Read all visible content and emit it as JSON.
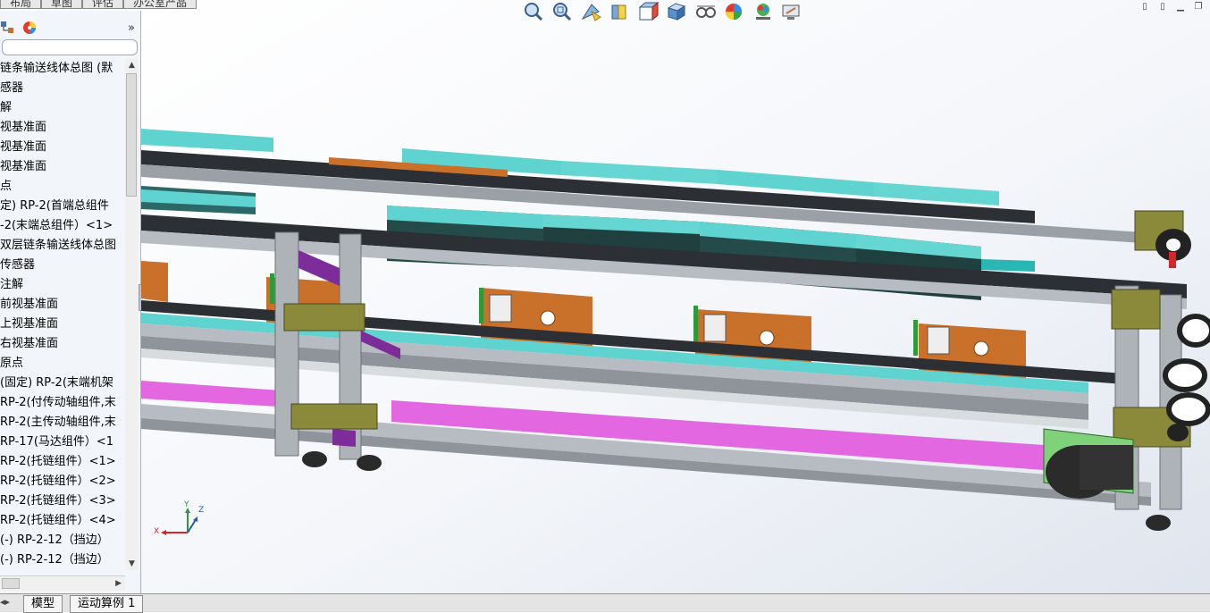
{
  "top_tabs": [
    "布局",
    "草图",
    "评估",
    "办公室产品"
  ],
  "panel": {
    "expand_label": "»",
    "tree_items": [
      "链条输送线体总图 (默",
      "感器",
      "解",
      "视基准面",
      "视基准面",
      "视基准面",
      "点",
      "定) RP-2(首端总组件",
      "-2(末端总组件）<1>",
      "双层链条输送线体总图",
      "传感器",
      "注解",
      "前视基准面",
      "上视基准面",
      "右视基准面",
      "原点",
      "(固定) RP-2(末端机架",
      "RP-2(付传动轴组件,末",
      "RP-2(主传动轴组件,末",
      "RP-17(马达组件）<1",
      "RP-2(托链组件）<1>",
      "RP-2(托链组件）<2>",
      "RP-2(托链组件）<3>",
      "RP-2(托链组件）<4>",
      "(-) RP-2-12（挡边）",
      "(-) RP-2-12（挡边）"
    ]
  },
  "bottom_tabs": [
    "模型",
    "运动算例 1"
  ],
  "triad": {
    "x_label": "X",
    "y_label": "Y",
    "z_label": "Z"
  },
  "heads_up_toolbar": [
    "zoom-to-fit-icon",
    "zoom-to-area-icon",
    "previous-view-icon",
    "section-view-icon",
    "view-orientation-icon",
    "display-style-icon",
    "hide-show-items-icon",
    "edit-appearance-icon",
    "apply-scene-icon",
    "view-settings-icon"
  ],
  "colors": {
    "cyan": "#5fd3d0",
    "dark_teal": "#244b4a",
    "orange": "#c9702a",
    "magenta": "#e267e0",
    "purple": "#7d2d9a",
    "olive": "#8a8a3a",
    "aluminum": "#b7bcc2"
  }
}
